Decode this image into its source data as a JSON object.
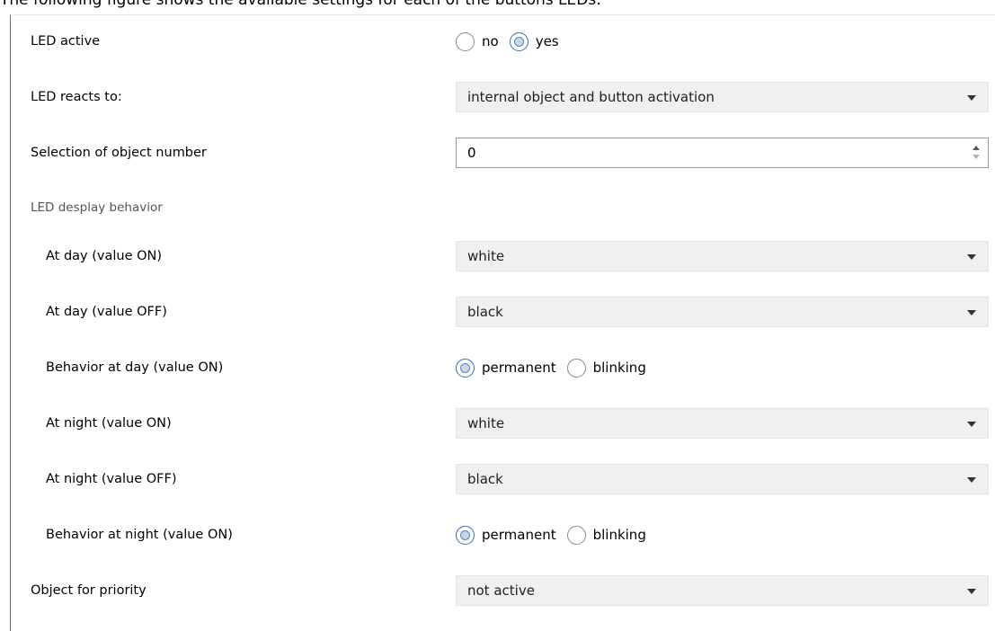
{
  "caption": "The following figure shows the available settings for each of the buttons LEDs:",
  "accent_color": "#3c6ab3",
  "rows": [
    {
      "label": "LED active",
      "no": "no",
      "yes": "yes",
      "selected": "yes"
    },
    {
      "label": "LED reacts to:",
      "value": "internal object and button activation"
    },
    {
      "label": "Selection of object number",
      "value": "0"
    },
    {
      "label": "LED desplay behavior"
    },
    {
      "label": "At day (value ON)",
      "value": "white"
    },
    {
      "label": "At day (value OFF)",
      "value": "black"
    },
    {
      "label": "Behavior at day (value ON)",
      "permanent": "permanent",
      "blinking": "blinking",
      "selected": "permanent"
    },
    {
      "label": "At night (value ON)",
      "value": "white"
    },
    {
      "label": "At night (value OFF)",
      "value": "black"
    },
    {
      "label": "Behavior at night (value ON)",
      "permanent": "permanent",
      "blinking": "blinking",
      "selected": "permanent"
    },
    {
      "label": "Object for priority",
      "value": "not active"
    }
  ]
}
